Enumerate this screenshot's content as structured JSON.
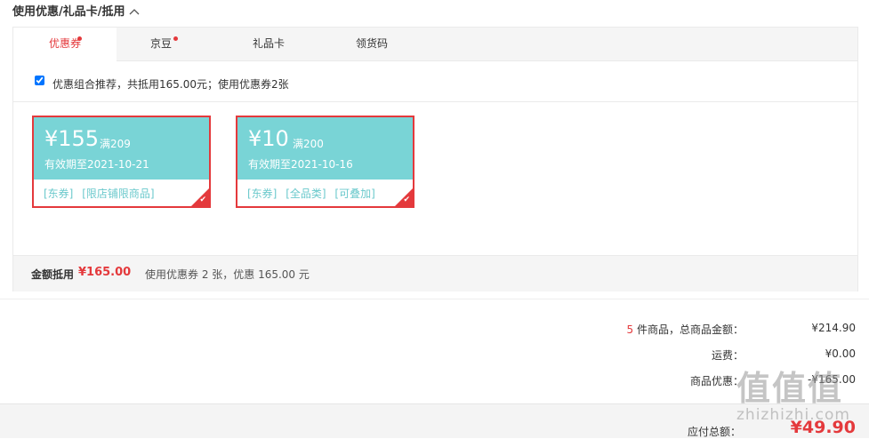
{
  "section": {
    "title": "使用优惠/礼品卡/抵用",
    "collapse_icon": "chevron-up-icon"
  },
  "tabs": [
    {
      "label": "优惠券",
      "active": true,
      "dot": true
    },
    {
      "label": "京豆",
      "active": false,
      "dot": true
    },
    {
      "label": "礼品卡",
      "active": false,
      "dot": false
    },
    {
      "label": "领货码",
      "active": false,
      "dot": false
    }
  ],
  "combo": {
    "checked": true,
    "text": "优惠组合推荐，共抵用165.00元；使用优惠券2张"
  },
  "coupons": [
    {
      "amount": "¥155",
      "condition": "满209",
      "expire": "有效期至2021-10-21",
      "tags": [
        "[东券]",
        "[限店铺限商品]"
      ],
      "selected": true
    },
    {
      "amount": "¥10",
      "condition": "满200",
      "expire": "有效期至2021-10-16",
      "tags": [
        "[东券]",
        "[全品类]",
        "[可叠加]"
      ],
      "selected": true
    }
  ],
  "summary": {
    "label": "金额抵用",
    "amount": "¥165.00",
    "desc": "使用优惠券 2 张，优惠 165.00 元"
  },
  "totals": {
    "count": "5",
    "count_suffix": " 件商品，总商品金额：",
    "goods_amount": "¥214.90",
    "shipping_label": "运费：",
    "shipping_value": "¥0.00",
    "discount_label": "商品优惠：",
    "discount_value": "-¥165.00",
    "pay_label": "应付总额：",
    "pay_value": "¥49.90"
  },
  "watermark": {
    "glyphs": "值值值",
    "site": "zhizhizhi.com"
  },
  "colors": {
    "accent": "#e4393c",
    "coupon_bg": "#79d4d6",
    "tag": "#6bc9cc"
  }
}
